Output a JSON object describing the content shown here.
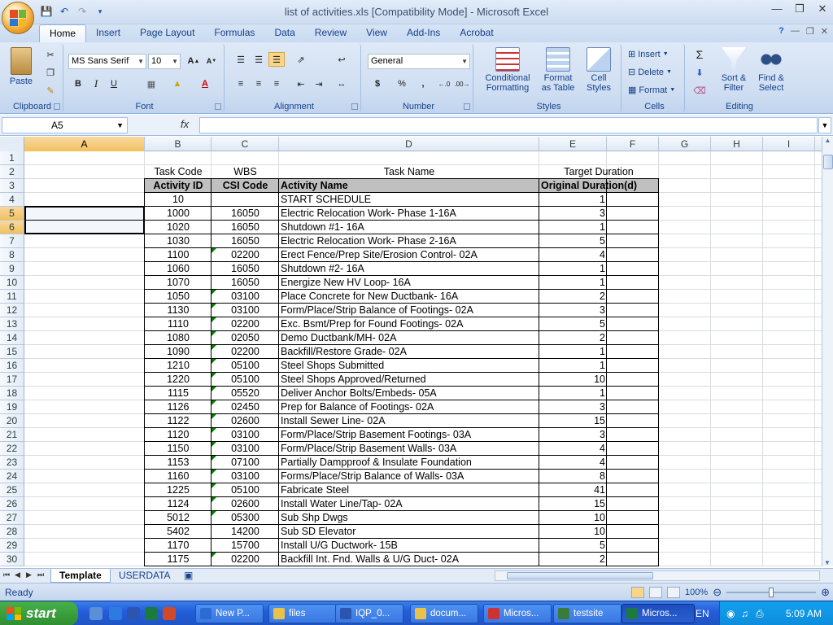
{
  "app": {
    "title": "list of activities.xls  [Compatibility Mode] - Microsoft Excel"
  },
  "tabs": [
    {
      "label": "Home",
      "active": true
    },
    {
      "label": "Insert"
    },
    {
      "label": "Page Layout"
    },
    {
      "label": "Formulas"
    },
    {
      "label": "Data"
    },
    {
      "label": "Review"
    },
    {
      "label": "View"
    },
    {
      "label": "Add-Ins"
    },
    {
      "label": "Acrobat"
    }
  ],
  "ribbon": {
    "clipboard": {
      "label": "Clipboard",
      "paste": "Paste"
    },
    "font": {
      "label": "Font",
      "name": "MS Sans Serif",
      "size": "10",
      "bold": "B",
      "italic": "I",
      "underline": "U"
    },
    "alignment": {
      "label": "Alignment"
    },
    "number": {
      "label": "Number",
      "format": "General",
      "currency": "$",
      "percent": "%",
      "comma": ","
    },
    "styles": {
      "label": "Styles",
      "conditional": "Conditional Formatting",
      "table": "Format as Table",
      "cell": "Cell Styles"
    },
    "cells": {
      "label": "Cells",
      "insert": "Insert",
      "delete": "Delete",
      "format": "Format"
    },
    "editing": {
      "label": "Editing",
      "sort": "Sort & Filter",
      "find": "Find & Select"
    }
  },
  "formula_bar": {
    "name_box": "A5",
    "fx": "fx",
    "value": ""
  },
  "columns": [
    "A",
    "B",
    "C",
    "D",
    "E",
    "F",
    "G",
    "H",
    "I"
  ],
  "selected_column": "A",
  "selected_rows": [
    5,
    6
  ],
  "header_row2": {
    "b": "Task Code",
    "c": "WBS",
    "d": "Task Name",
    "e": "Target Duration"
  },
  "header_row3": {
    "b": "Activity ID",
    "c": "CSI Code",
    "d": "Activity Name",
    "e": "Original Duration(d)"
  },
  "rows": [
    {
      "id": "10",
      "csi": "",
      "name": "START SCHEDULE",
      "dur": "1"
    },
    {
      "id": "1000",
      "csi": "16050",
      "name": "Electric Relocation Work- Phase 1-16A",
      "dur": "3"
    },
    {
      "id": "1020",
      "csi": "16050",
      "name": "Shutdown #1- 16A",
      "dur": "1"
    },
    {
      "id": "1030",
      "csi": "16050",
      "name": "Electric Relocation Work- Phase 2-16A",
      "dur": "5"
    },
    {
      "id": "1100",
      "csi": "02200",
      "name": "Erect Fence/Prep Site/Erosion Control- 02A",
      "dur": "4"
    },
    {
      "id": "1060",
      "csi": "16050",
      "name": "Shutdown #2- 16A",
      "dur": "1"
    },
    {
      "id": "1070",
      "csi": "16050",
      "name": "Energize New HV Loop- 16A",
      "dur": "1"
    },
    {
      "id": "1050",
      "csi": "03100",
      "name": "Place Concrete for New Ductbank- 16A",
      "dur": "2"
    },
    {
      "id": "1130",
      "csi": "03100",
      "name": "Form/Place/Strip Balance of Footings- 02A",
      "dur": "3"
    },
    {
      "id": "1110",
      "csi": "02200",
      "name": "Exc. Bsmt/Prep for Found Footings- 02A",
      "dur": "5"
    },
    {
      "id": "1080",
      "csi": "02050",
      "name": "Demo Ductbank/MH- 02A",
      "dur": "2"
    },
    {
      "id": "1090",
      "csi": "02200",
      "name": "Backfill/Restore Grade- 02A",
      "dur": "1"
    },
    {
      "id": "1210",
      "csi": "05100",
      "name": "Steel Shops Submitted",
      "dur": "1"
    },
    {
      "id": "1220",
      "csi": "05100",
      "name": "Steel Shops Approved/Returned",
      "dur": "10"
    },
    {
      "id": "1115",
      "csi": "05520",
      "name": "Deliver Anchor Bolts/Embeds- 05A",
      "dur": "1"
    },
    {
      "id": "1126",
      "csi": "02450",
      "name": "Prep for Balance of Footings- 02A",
      "dur": "3"
    },
    {
      "id": "1122",
      "csi": "02600",
      "name": "Install Sewer Line- 02A",
      "dur": "15"
    },
    {
      "id": "1120",
      "csi": "03100",
      "name": "Form/Place/Strip Basement Footings- 03A",
      "dur": "3"
    },
    {
      "id": "1150",
      "csi": "03100",
      "name": "Form/Place/Strip Basement Walls- 03A",
      "dur": "4"
    },
    {
      "id": "1153",
      "csi": "07100",
      "name": "Partially Dampproof & Insulate Foundation",
      "dur": "4"
    },
    {
      "id": "1160",
      "csi": "03100",
      "name": "Forms/Place/Strip Balance of Walls- 03A",
      "dur": "8"
    },
    {
      "id": "1225",
      "csi": "05100",
      "name": "Fabricate Steel",
      "dur": "41"
    },
    {
      "id": "1124",
      "csi": "02600",
      "name": "Install Water Line/Tap- 02A",
      "dur": "15"
    },
    {
      "id": "5012",
      "csi": "05300",
      "name": "Sub Shp Dwgs",
      "dur": "10"
    },
    {
      "id": "5402",
      "csi": "14200",
      "name": "Sub SD Elevator",
      "dur": "10"
    },
    {
      "id": "1170",
      "csi": "15700",
      "name": "Install U/G Ductwork- 15B",
      "dur": "5"
    },
    {
      "id": "1175",
      "csi": "02200",
      "name": "Backfill Int. Fnd. Walls & U/G Duct- 02A",
      "dur": "2"
    }
  ],
  "sheets": [
    {
      "label": "Template",
      "active": true
    },
    {
      "label": "USERDATA"
    }
  ],
  "status": {
    "text": "Ready",
    "zoom": "100%"
  },
  "taskbar": {
    "start": "start",
    "tasks": [
      {
        "label": "New P...",
        "color": "#2b6cd4"
      },
      {
        "label": "files",
        "color": "#e8c24a"
      },
      {
        "label": "IQP_0...",
        "color": "#2b55b0"
      },
      {
        "label": "docum...",
        "color": "#e8c24a"
      },
      {
        "label": "Micros...",
        "color": "#c33"
      },
      {
        "label": "testsite",
        "color": "#3a7a3a"
      },
      {
        "label": "Micros...",
        "color": "#1d7a3e",
        "active": true
      }
    ],
    "lang": "EN",
    "clock": "5:09 AM"
  }
}
